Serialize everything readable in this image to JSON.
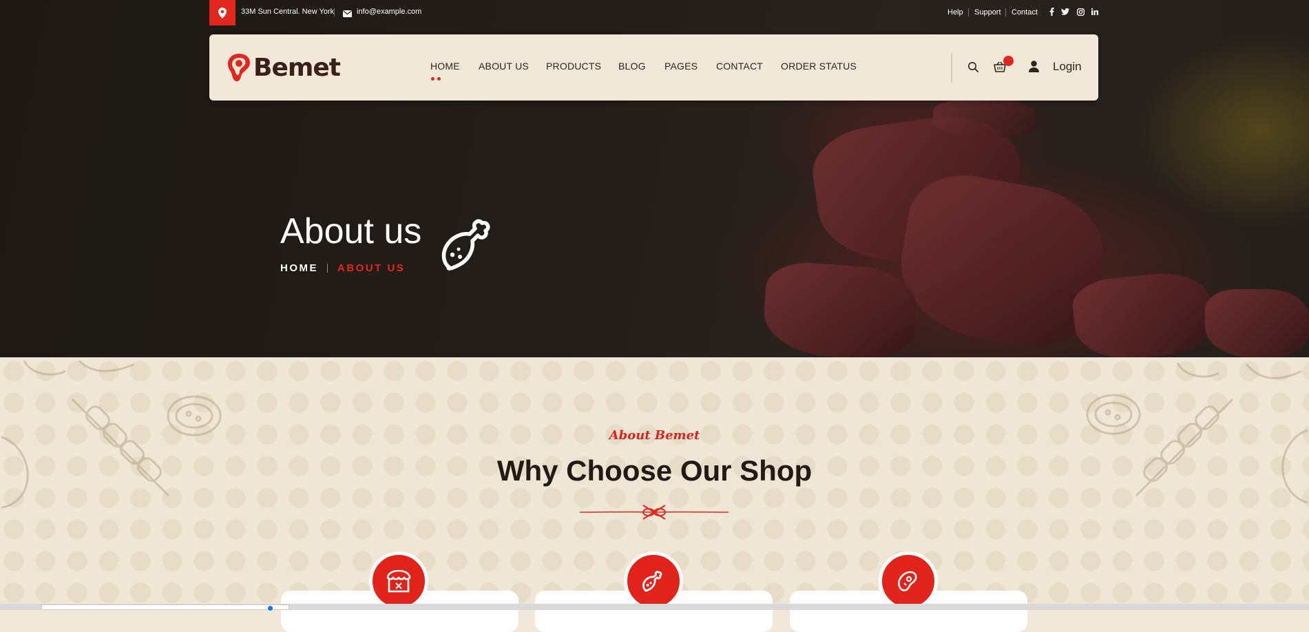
{
  "topbar": {
    "address": "33M Sun Central. New York",
    "email": "info@example.com",
    "links": [
      "Help",
      "Support",
      "Contact"
    ],
    "social_icons": [
      "facebook-icon",
      "twitter-icon",
      "instagram-icon",
      "linkedin-icon"
    ]
  },
  "header": {
    "logo_text": "Bemet",
    "menu": [
      "HOME",
      "ABOUT US",
      "PRODUCTS",
      "BLOG",
      "PAGES",
      "CONTACT",
      "ORDER STATUS"
    ],
    "active_menu": "HOME",
    "login_label": "Login",
    "icons": [
      "search-icon",
      "cart-icon",
      "user-icon"
    ]
  },
  "hero": {
    "title": "About us",
    "breadcrumb_home": "HOME",
    "breadcrumb_current": "ABOUT US"
  },
  "about": {
    "subtitle": "About Bemet",
    "title": "Why Choose Our Shop",
    "feature_icons": [
      "shop-icon",
      "chicken-leg-icon",
      "steak-icon"
    ]
  },
  "colors": {
    "accent": "#e2281c",
    "nav_bg": "#f1e8d9",
    "section_bg": "#f0e6d6",
    "dark_text": "#241a15"
  }
}
